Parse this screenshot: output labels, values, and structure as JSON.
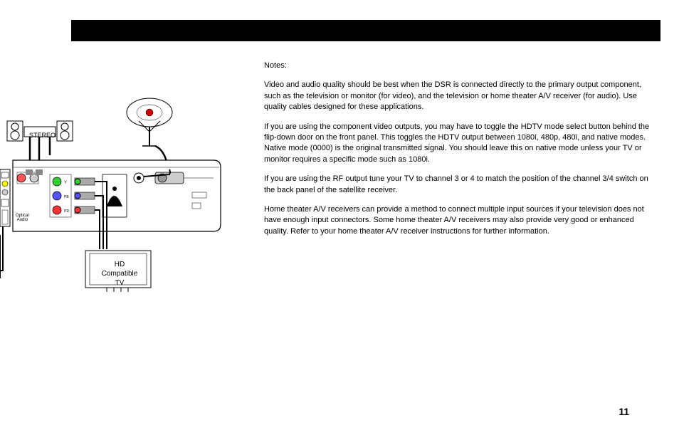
{
  "header": {
    "bar": ""
  },
  "notes": {
    "heading": "Notes:",
    "p1": "Video and audio quality should be best when the DSR is connected directly to the primary output component, such as the television or monitor (for video), and the television or home theater A/V receiver (for audio). Use quality cables designed for these applications.",
    "p2": "If you are using the component video outputs, you may have to toggle the HDTV mode select button behind the flip-down door on the front panel.  This toggles the HDTV output between 1080i, 480p, 480i, and native modes.  Native mode (0000) is the original transmitted signal. You should leave this on native mode unless your TV or monitor requires a specific mode such as 1080i.",
    "p3": "If you are using the RF output tune your TV to channel 3 or 4 to match the position of the channel 3/4 switch on the back panel of the satellite receiver.",
    "p4": "Home theater A/V receivers can provide a method to connect multiple input sources if your television does not have enough input connectors. Some home theater A/V receivers may also provide very good or enhanced quality. Refer to your home theater A/V receiver instructions for further information."
  },
  "diagram": {
    "stereo_label": "STEREO",
    "optical_label_line1": "Optical",
    "optical_label_line2": "Audio",
    "hd_label_line1": "HD",
    "hd_label_line2": "Compatible",
    "hd_label_line3": "TV",
    "component_y": "Y",
    "component_pb": "PB",
    "component_pr": "PR"
  },
  "page_number": "11"
}
